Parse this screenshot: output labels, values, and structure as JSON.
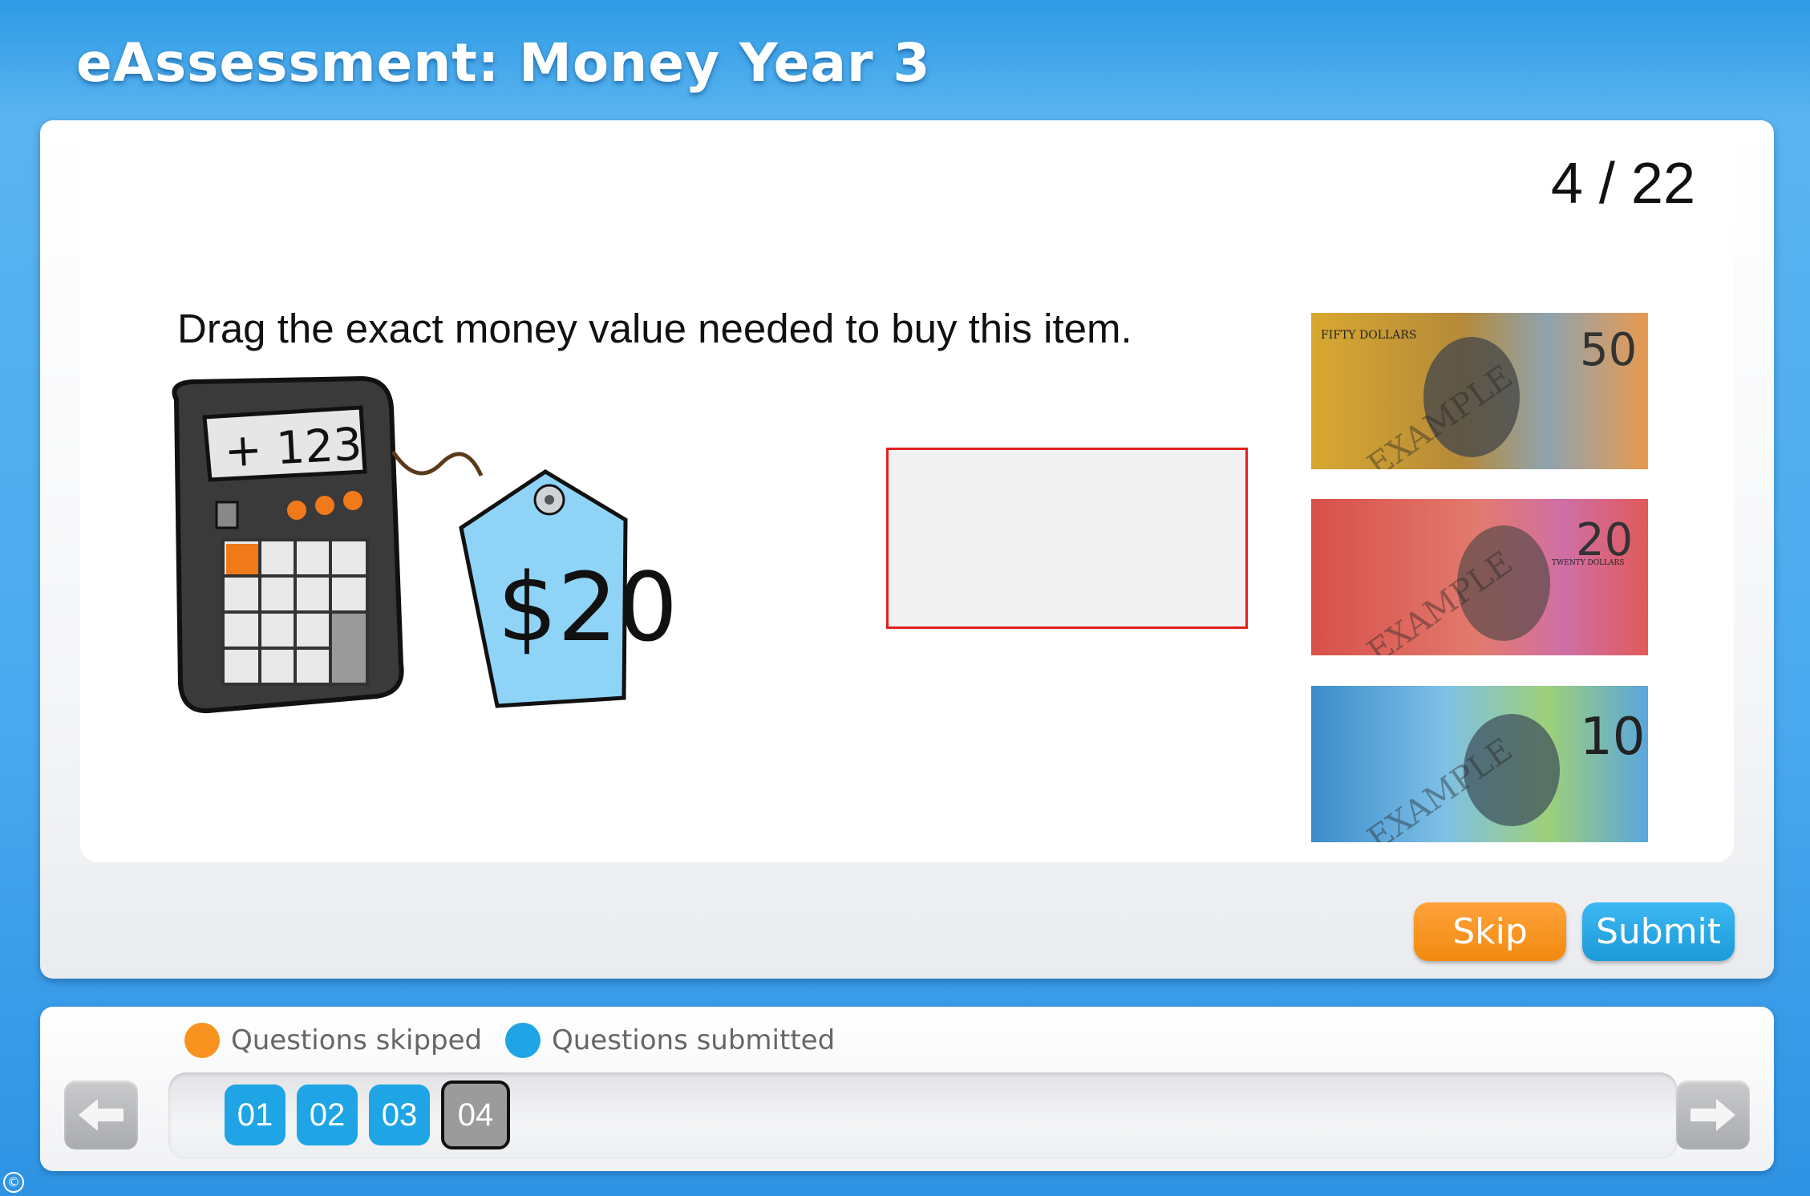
{
  "app": {
    "title": "eAssessment: Money Year 3"
  },
  "question": {
    "counter": "4 / 22",
    "prompt": "Drag the exact money value needed to buy this item.",
    "item": {
      "calculator_display": "+ 123",
      "price_tag": "$20"
    },
    "money_options": [
      {
        "name": "fifty-dollar-note",
        "value_label": "50",
        "caption": "FIFTY DOLLARS",
        "watermark": "EXAMPLE",
        "colors": [
          "#e8b53a",
          "#c98b2a",
          "#7aa0b8"
        ]
      },
      {
        "name": "twenty-dollar-note",
        "value_label": "20",
        "caption": "TWENTY DOLLARS",
        "watermark": "EXAMPLE",
        "colors": [
          "#d9534a",
          "#e57d6a",
          "#c96aa8"
        ]
      },
      {
        "name": "ten-dollar-note",
        "value_label": "10",
        "caption": "",
        "watermark": "EXAMPLE",
        "colors": [
          "#3f8fd0",
          "#6fb8e8",
          "#a8d86a"
        ]
      }
    ]
  },
  "actions": {
    "skip_label": "Skip",
    "submit_label": "Submit"
  },
  "legend": {
    "skipped_label": "Questions skipped",
    "submitted_label": "Questions submitted",
    "skipped_color": "#f7931e",
    "submitted_color": "#1fa5e5"
  },
  "navigation": {
    "questions": [
      "01",
      "02",
      "03",
      "04"
    ],
    "current": "04"
  },
  "footer": {
    "copyright_symbol": "©"
  }
}
